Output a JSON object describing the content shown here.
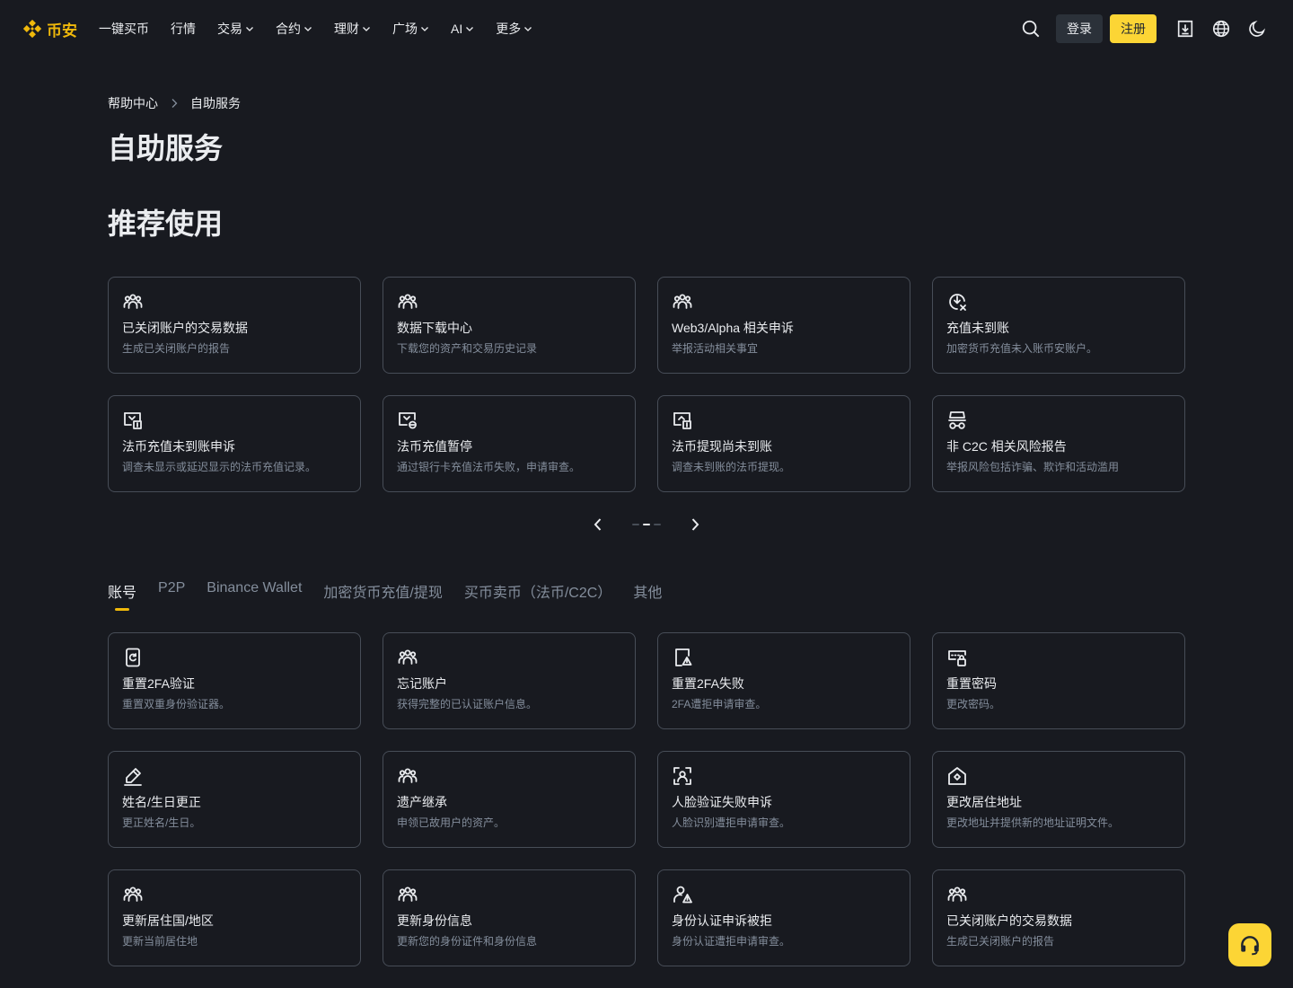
{
  "brand": {
    "name": "币安",
    "color": "#f0b90b"
  },
  "nav": {
    "items": [
      {
        "label": "一键买币",
        "dropdown": false
      },
      {
        "label": "行情",
        "dropdown": false
      },
      {
        "label": "交易",
        "dropdown": true
      },
      {
        "label": "合约",
        "dropdown": true
      },
      {
        "label": "理财",
        "dropdown": true
      },
      {
        "label": "广场",
        "dropdown": true
      },
      {
        "label": "AI",
        "dropdown": true
      },
      {
        "label": "更多",
        "dropdown": true
      }
    ]
  },
  "header": {
    "login_label": "登录",
    "register_label": "注册"
  },
  "breadcrumb": {
    "home": "帮助中心",
    "current": "自助服务"
  },
  "page_title": "自助服务",
  "recommended": {
    "title": "推荐使用",
    "cards": [
      {
        "icon": "users-icon",
        "title": "已关闭账户的交易数据",
        "desc": "生成已关闭账户的报告"
      },
      {
        "icon": "users-icon",
        "title": "数据下载中心",
        "desc": "下载您的资产和交易历史记录"
      },
      {
        "icon": "users-icon",
        "title": "Web3/Alpha 相关申诉",
        "desc": "举报活动相关事宜"
      },
      {
        "icon": "deposit-failed-icon",
        "title": "充值未到账",
        "desc": "加密货币充值未入账币安账户。"
      },
      {
        "icon": "fiat-deposit-icon",
        "title": "法币充值未到账申诉",
        "desc": "调查未显示或延迟显示的法币充值记录。"
      },
      {
        "icon": "fiat-pause-icon",
        "title": "法币充值暂停",
        "desc": "通过银行卡充值法币失败，申请审查。"
      },
      {
        "icon": "fiat-withdraw-icon",
        "title": "法币提现尚未到账",
        "desc": "调查未到账的法币提现。"
      },
      {
        "icon": "risk-report-icon",
        "title": "非 C2C 相关风险报告",
        "desc": "举报风险包括诈骗、欺诈和活动滥用"
      }
    ],
    "pager": {
      "pages": 3,
      "active": 2
    }
  },
  "tabs": [
    {
      "label": "账号",
      "active": true
    },
    {
      "label": "P2P",
      "active": false
    },
    {
      "label": "Binance Wallet",
      "active": false
    },
    {
      "label": "加密货币充值/提现",
      "active": false
    },
    {
      "label": "买币卖币（法币/C2C）",
      "active": false
    },
    {
      "label": "其他",
      "active": false
    }
  ],
  "account_cards": [
    {
      "icon": "reset-2fa-icon",
      "title": "重置2FA验证",
      "desc": "重置双重身份验证器。"
    },
    {
      "icon": "users-icon",
      "title": "忘记账户",
      "desc": "获得完整的已认证账户信息。"
    },
    {
      "icon": "2fa-failed-icon",
      "title": "重置2FA失败",
      "desc": "2FA遭拒申请审查。"
    },
    {
      "icon": "password-icon",
      "title": "重置密码",
      "desc": "更改密码。"
    },
    {
      "icon": "edit-icon",
      "title": "姓名/生日更正",
      "desc": "更正姓名/生日。"
    },
    {
      "icon": "users-icon",
      "title": "遗产继承",
      "desc": "申领已故用户的资产。"
    },
    {
      "icon": "face-scan-icon",
      "title": "人脸验证失败申诉",
      "desc": "人脸识别遭拒申请审查。"
    },
    {
      "icon": "home-icon",
      "title": "更改居住地址",
      "desc": "更改地址并提供新的地址证明文件。"
    },
    {
      "icon": "users-icon",
      "title": "更新居住国/地区",
      "desc": "更新当前居住地"
    },
    {
      "icon": "users-icon",
      "title": "更新身份信息",
      "desc": "更新您的身份证件和身份信息"
    },
    {
      "icon": "user-warning-icon",
      "title": "身份认证申诉被拒",
      "desc": "身份认证遭拒申请审查。"
    },
    {
      "icon": "users-icon",
      "title": "已关闭账户的交易数据",
      "desc": "生成已关闭账户的报告"
    }
  ],
  "colors": {
    "background": "#181a20",
    "card_border": "#474d57",
    "accent": "#fcd535",
    "muted": "#848e9c"
  }
}
